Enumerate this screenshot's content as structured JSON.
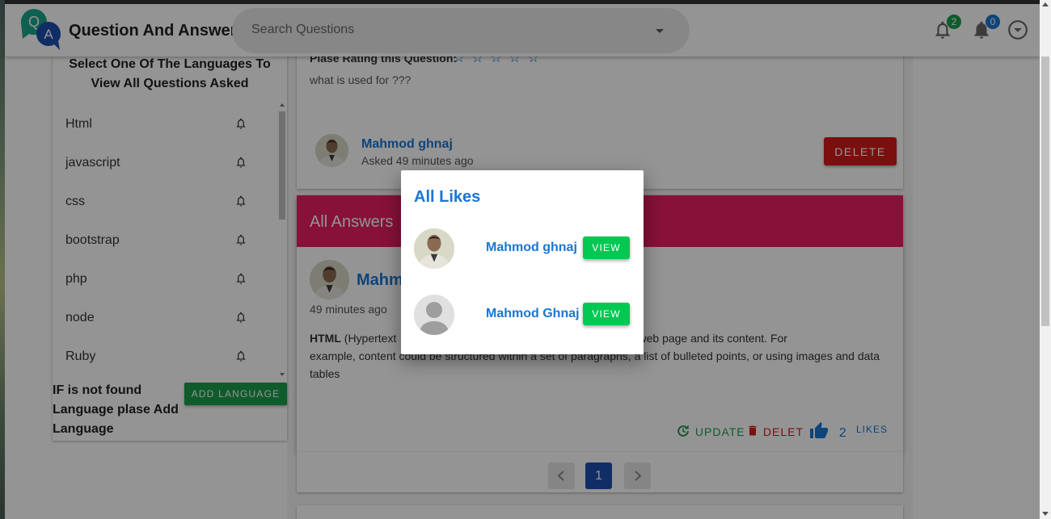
{
  "app": {
    "title": "Question And Answer",
    "logo_letters": [
      "Q",
      "A"
    ]
  },
  "search": {
    "placeholder": "Search Questions"
  },
  "header": {
    "notifications_badge": "2",
    "messages_badge": "0",
    "colors": {
      "badge_green": "#1a9e4b",
      "badge_blue": "#1976d2"
    }
  },
  "languages": {
    "heading": "Select One Of The Languages To View All Questions Asked",
    "items": [
      {
        "label": "Html"
      },
      {
        "label": "javascript"
      },
      {
        "label": "css"
      },
      {
        "label": "bootstrap"
      },
      {
        "label": "php"
      },
      {
        "label": "node"
      },
      {
        "label": "Ruby"
      }
    ],
    "not_found_text": "IF is not found Language plase Add Language",
    "add_button": "ADD LANGUAGE"
  },
  "question": {
    "rating_label": "Plase Rating this Question:",
    "stars": [
      "☆",
      "☆",
      "☆",
      "☆",
      "☆"
    ],
    "text": "what is used for ???",
    "author": "Mahmod ghnaj",
    "asked": "Asked 49 minutes ago",
    "delete_button": "DELETE"
  },
  "answers": {
    "title": "All Answers",
    "author_partial": "Mahm",
    "time": "49 minutes ago",
    "body_bold": "HTML",
    "body_line1_start": " (Hypertext",
    "body_line1_end": "ructure a web page and its content. For",
    "body_line2_start": "example, content could be structured within a set of paragraphs, a list of bulleted points, or using images and data",
    "body_line3": "tables",
    "update_label": "UPDATE",
    "delete_label": "DELET",
    "likes_count": "2",
    "likes_label": "LIKES",
    "colors": {
      "header": "#e91e63",
      "update": "#1a9e4b",
      "delete": "#d31a1a",
      "likes": "#1976d2"
    }
  },
  "pagination": {
    "current": "1",
    "prev_icon": "chevron-left-icon",
    "next_icon": "chevron-right-icon"
  },
  "modal": {
    "title": "All Likes",
    "likes": [
      {
        "name": "Mahmod ghnaj",
        "button": "VIEW",
        "avatar": "photo"
      },
      {
        "name": "Mahmod Ghnaj",
        "button": "VIEW",
        "avatar": "placeholder"
      }
    ]
  }
}
